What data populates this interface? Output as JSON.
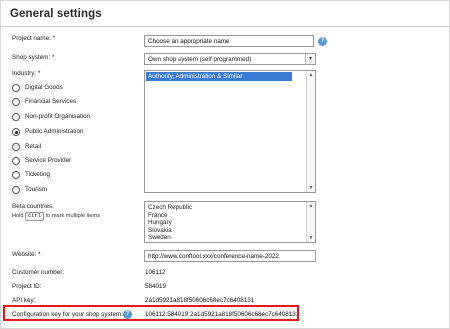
{
  "header": {
    "title": "General settings"
  },
  "form": {
    "project_name": {
      "label": "Project name:",
      "required": "*",
      "value": "Choose an appropriate name"
    },
    "shop_system": {
      "label": "Shop system:",
      "required": "*",
      "value": "Own shop system (self programmed)"
    },
    "industry": {
      "label": "Industry:",
      "required": "*",
      "options": [
        {
          "label": "Digital Goods",
          "selected": false
        },
        {
          "label": "Financial Services",
          "selected": false
        },
        {
          "label": "Non-profit Organisation",
          "selected": false
        },
        {
          "label": "Public Administration",
          "selected": true
        },
        {
          "label": "Retail",
          "selected": false
        },
        {
          "label": "Service Provider",
          "selected": false
        },
        {
          "label": "Ticketing",
          "selected": false
        },
        {
          "label": "Tourism",
          "selected": false
        }
      ],
      "subcategory_selected": "Authority, Administration & Similar"
    },
    "beta_countries": {
      "label": "Beta countries:",
      "hint_prefix": "Hold",
      "hint_key": "Ctrl",
      "hint_suffix": "to mark multiple items",
      "options": [
        "Czech Republic",
        "France",
        "Hungary",
        "Slovakia",
        "Sweden"
      ]
    },
    "website": {
      "label": "Website:",
      "required": "*",
      "value": "http://www.conftool.xxx/conference-name-2022"
    },
    "customer_number": {
      "label": "Customer number:",
      "value": "106112"
    },
    "project_id": {
      "label": "Project ID:",
      "value": "584019"
    },
    "api_key": {
      "label": "API key:",
      "value": "2a1d5921a818f50606c68ec7c6408131"
    },
    "config_key": {
      "label": "Configuration key for your shop system:",
      "value": "106112:584019:2a1d5921a818f50606c68ec7c6408131"
    }
  },
  "icons": {
    "help": "help-icon",
    "dropdown": "chevron-down-icon"
  },
  "colors": {
    "selection": "#3a7bd5",
    "help_icon": "#5b9bd5",
    "highlight_box": "#e01b1b"
  }
}
